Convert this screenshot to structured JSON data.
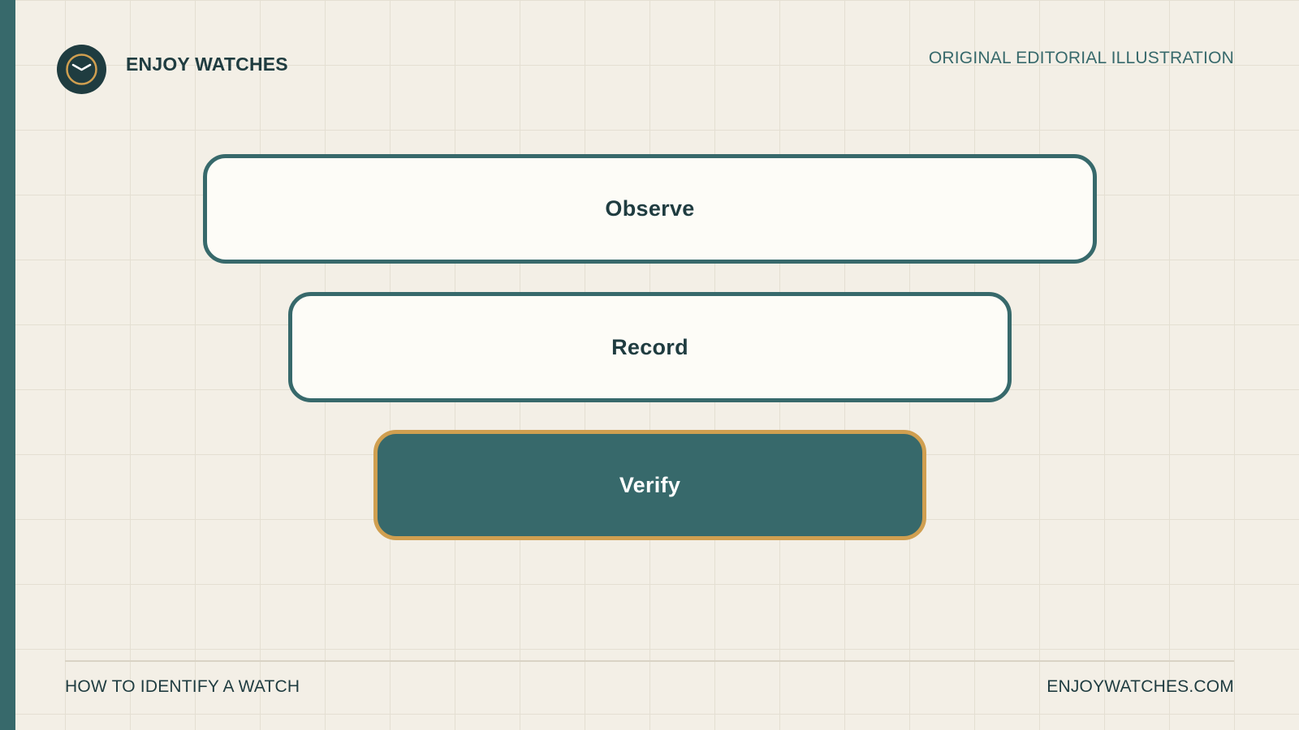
{
  "header": {
    "brand": "ENJOY WATCHES",
    "logo_icon": "watch-icon",
    "tagline": "ORIGINAL EDITORIAL ILLUSTRATION"
  },
  "diagram": {
    "type": "funnel-steps",
    "steps": [
      {
        "label": "Observe",
        "style": "outline"
      },
      {
        "label": "Record",
        "style": "outline"
      },
      {
        "label": "Verify",
        "style": "filled"
      }
    ]
  },
  "footer": {
    "left": "HOW TO IDENTIFY A WATCH",
    "right": "ENJOYWATCHES.COM"
  },
  "colors": {
    "background": "#f3efe6",
    "primary": "#37696b",
    "dark": "#1f3c40",
    "accent": "#d09f50",
    "card": "#fdfcf7"
  }
}
